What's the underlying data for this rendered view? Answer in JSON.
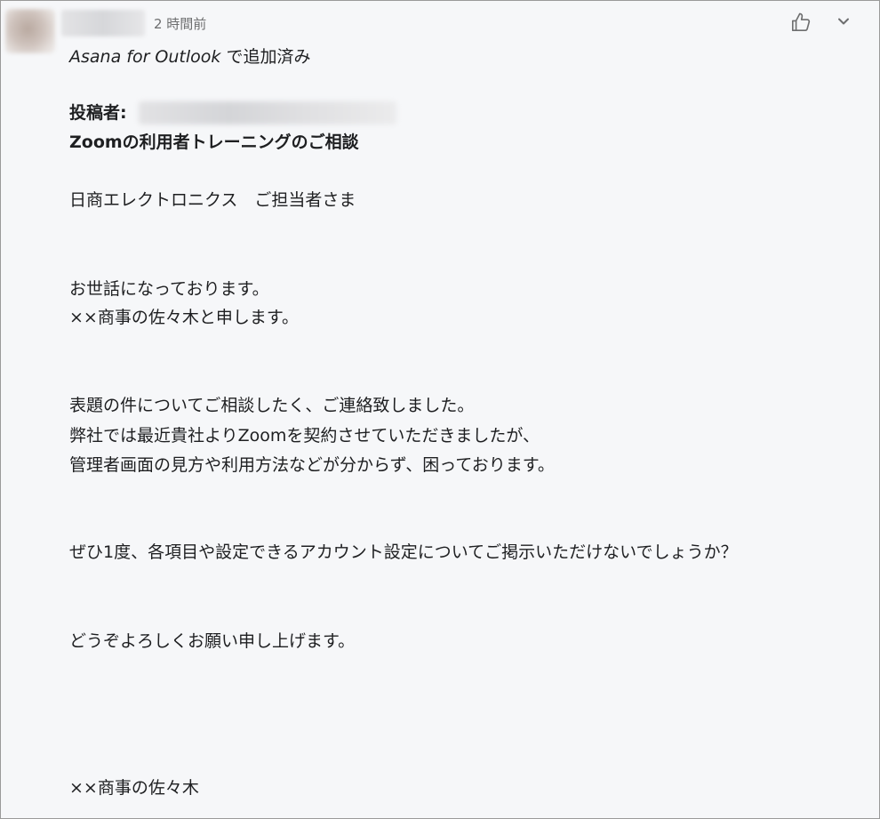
{
  "comment": {
    "timestamp": "2 時間前",
    "source": {
      "app_name": "Asana for Outlook",
      "suffix": " で追加済み"
    },
    "sender_label": "投稿者:",
    "subject": "Zoomの利用者トレーニングのご相談",
    "body": {
      "greeting": "日商エレクトロニクス　ご担当者さま",
      "line1": "お世話になっております。",
      "line2": "××商事の佐々木と申します。",
      "line3": "表題の件についてご相談したく、ご連絡致しました。",
      "line4": "弊社では最近貴社よりZoomを契約させていただきましたが、",
      "line5": "管理者画面の見方や利用方法などが分からず、困っております。",
      "line6": "ぜひ1度、各項目や設定できるアカウント設定についてご掲示いただけないでしょうか？",
      "line7": "どうぞよろしくお願い申し上げます。",
      "signature": "××商事の佐々木"
    }
  },
  "icons": {
    "like": "thumbs-up-icon",
    "more": "chevron-down-icon"
  },
  "colors": {
    "background": "#f6f7f9",
    "text": "#1e1f21",
    "muted_text": "#6d6e6f",
    "icon": "#6d6e6f"
  }
}
